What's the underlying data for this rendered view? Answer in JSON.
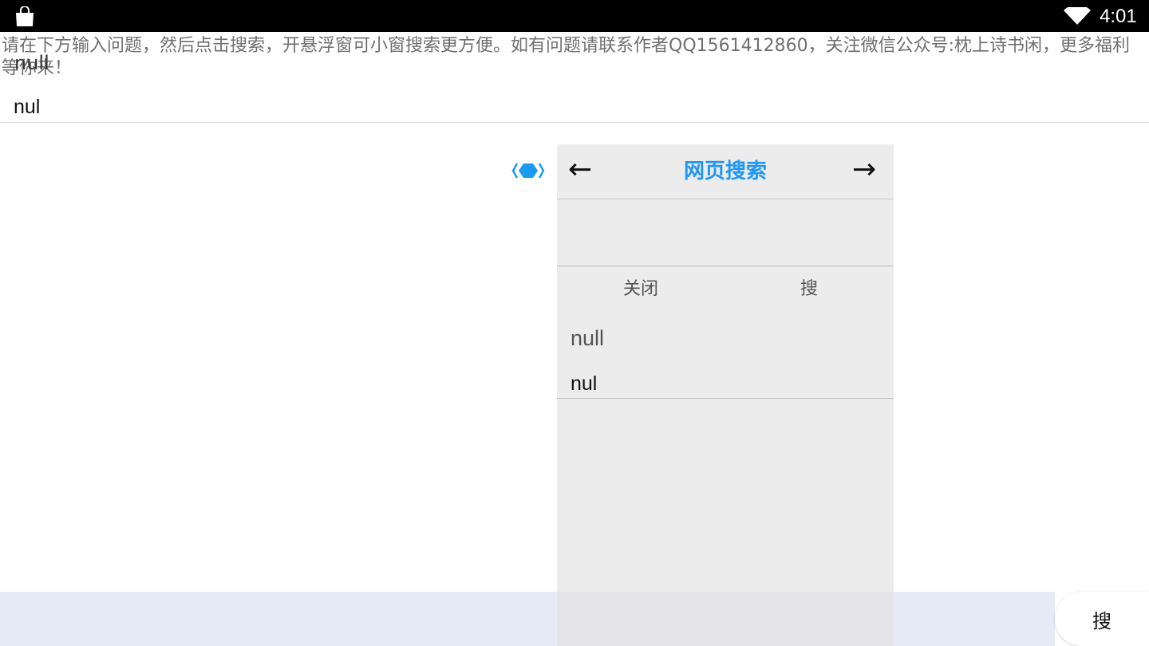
{
  "status_bar": {
    "time": "4:01",
    "icons": [
      "shopping-bag-icon",
      "wifi-icon"
    ]
  },
  "instruction": "请在下方输入问题，然后点击搜索，开悬浮窗可小窗搜索更方便。如有问题请联系作者QQ1561412860，关注微信公众号:枕上诗书闲，更多福利等你来！",
  "overlap_text": "null",
  "main_input_value": "nul",
  "float_handle_icon": "float-window-handle-icon",
  "panel": {
    "back_arrow": "←",
    "forward_arrow": "→",
    "title": "网页搜索",
    "search_value": "",
    "close_label": "关闭",
    "search_label": "搜",
    "result_null": "null",
    "result_nul": "nul"
  },
  "bottom": {
    "search_label": "搜"
  },
  "colors": {
    "status_bar": "#000000",
    "accent": "#2196f3",
    "panel_bg": "#ececec",
    "bottom_bar": "#e6eaf6"
  }
}
